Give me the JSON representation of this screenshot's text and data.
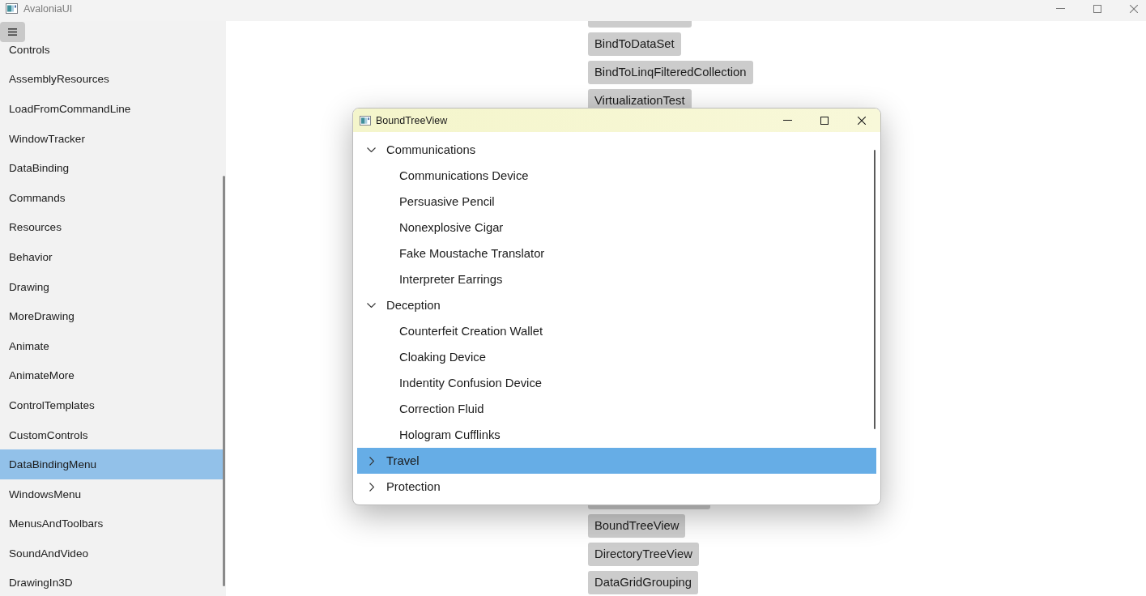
{
  "window": {
    "title": "AvaloniaUI"
  },
  "sidebar": {
    "items": [
      {
        "label": "Controls",
        "selected": false
      },
      {
        "label": "AssemblyResources",
        "selected": false
      },
      {
        "label": "LoadFromCommandLine",
        "selected": false
      },
      {
        "label": "WindowTracker",
        "selected": false
      },
      {
        "label": "DataBinding",
        "selected": false
      },
      {
        "label": "Commands",
        "selected": false
      },
      {
        "label": "Resources",
        "selected": false
      },
      {
        "label": "Behavior",
        "selected": false
      },
      {
        "label": "Drawing",
        "selected": false
      },
      {
        "label": "MoreDrawing",
        "selected": false
      },
      {
        "label": "Animate",
        "selected": false
      },
      {
        "label": "AnimateMore",
        "selected": false
      },
      {
        "label": "ControlTemplates",
        "selected": false
      },
      {
        "label": "CustomControls",
        "selected": false
      },
      {
        "label": "DataBindingMenu",
        "selected": true
      },
      {
        "label": "WindowsMenu",
        "selected": false
      },
      {
        "label": "MenusAndToolbars",
        "selected": false
      },
      {
        "label": "SoundAndVideo",
        "selected": false
      },
      {
        "label": "DrawingIn3D",
        "selected": false
      }
    ]
  },
  "demo_buttons": {
    "above_dialog": [
      "BindToDataSet",
      "BindToLinqFilteredCollection",
      "VirtualizationTest"
    ],
    "below_dialog": [
      "BoundTreeView",
      "DirectoryTreeView",
      "DataGridGrouping"
    ]
  },
  "dialog": {
    "title": "BoundTreeView",
    "tree": [
      {
        "label": "Communications",
        "expanded": true,
        "selected": false,
        "children": [
          {
            "label": "Communications Device",
            "selected": false
          },
          {
            "label": "Persuasive Pencil",
            "selected": false
          },
          {
            "label": "Nonexplosive Cigar",
            "selected": false
          },
          {
            "label": "Fake Moustache Translator",
            "selected": false
          },
          {
            "label": "Interpreter Earrings",
            "selected": false
          }
        ]
      },
      {
        "label": "Deception",
        "expanded": true,
        "selected": false,
        "children": [
          {
            "label": "Counterfeit Creation Wallet",
            "selected": false
          },
          {
            "label": "Cloaking Device",
            "selected": false
          },
          {
            "label": "Indentity Confusion Device",
            "selected": false
          },
          {
            "label": "Correction Fluid",
            "selected": false
          },
          {
            "label": "Hologram Cufflinks",
            "selected": false
          }
        ]
      },
      {
        "label": "Travel",
        "expanded": false,
        "selected": true
      },
      {
        "label": "Protection",
        "expanded": false,
        "selected": false
      }
    ]
  }
}
